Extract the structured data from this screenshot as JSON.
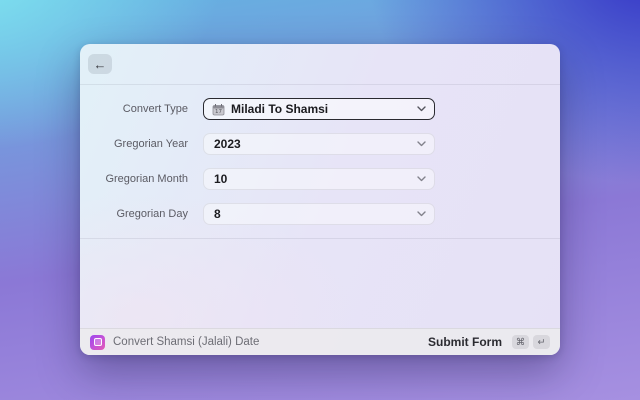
{
  "colors": {
    "desktop_gradient_top_left": "#80e3f0",
    "desktop_gradient_top_right": "#3431c6",
    "desktop_gradient_bottom_left": "#8b78d6",
    "desktop_gradient_bottom_right": "#a690e1",
    "focus_border": "#2a2a30",
    "extension_icon_gradient": [
      "#9b46ee",
      "#e45ab4"
    ]
  },
  "header": {
    "back_icon": "←"
  },
  "form": {
    "fields": [
      {
        "label": "Convert Type",
        "value": "Miladi To Shamsi",
        "icon": "calendar-icon"
      },
      {
        "label": "Gregorian Year",
        "value": "2023"
      },
      {
        "label": "Gregorian Month",
        "value": "10"
      },
      {
        "label": "Gregorian Day",
        "value": "8"
      }
    ]
  },
  "footer": {
    "extension_icon": "calendar-extension-icon",
    "command_title": "Convert Shamsi (Jalali) Date",
    "submit_label": "Submit Form",
    "keys": [
      "⌘",
      "↵"
    ]
  }
}
